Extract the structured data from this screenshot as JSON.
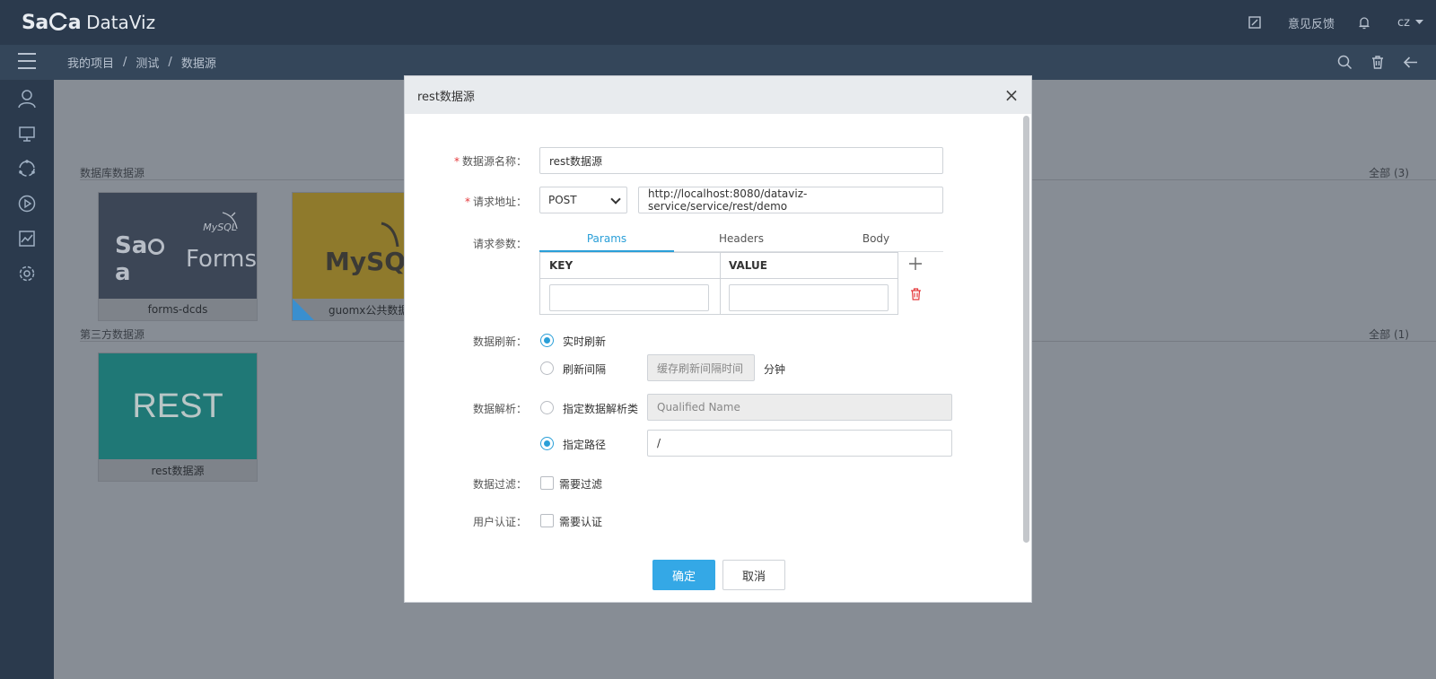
{
  "app": {
    "logo_text": "DataViz",
    "feedback": "意见反馈",
    "user": "cz"
  },
  "breadcrumb": [
    "我的项目",
    "测试",
    "数据源"
  ],
  "breadcrumb_sep": "/",
  "sections": {
    "database": {
      "title": "数据库数据源",
      "count": "全部  (3)"
    },
    "third_party": {
      "title": "第三方数据源",
      "count": "全部  (1)"
    }
  },
  "cards": {
    "forms": {
      "caption": "forms-dcds",
      "logo_text": "Forms",
      "badge": "MySQL"
    },
    "mysql": {
      "caption": "guomx公共数据",
      "logo_text": "MySQL"
    },
    "rest": {
      "caption": "rest数据源",
      "logo_text": "REST"
    }
  },
  "colors": {
    "forms_bg": "#3c4656",
    "mysql_bg": "#8f7a2c",
    "rest_bg": "#1f7876",
    "accent": "#34a8e6"
  },
  "modal": {
    "title": "rest数据源",
    "close": "×",
    "fields": {
      "name_label": "数据源名称：",
      "name_value": "rest数据源",
      "url_label": "请求地址：",
      "method": "POST",
      "url_value": "http://localhost:8080/dataviz-service/service/rest/demo",
      "params_label": "请求参数：",
      "tabs": [
        "Params",
        "Headers",
        "Body"
      ],
      "kv_headers": [
        "KEY",
        "VALUE"
      ],
      "refresh_label": "数据刷新：",
      "refresh_realtime": "实时刷新",
      "refresh_interval": "刷新间隔",
      "refresh_interval_placeholder": "缓存刷新间隔时间",
      "refresh_unit": "分钟",
      "parse_label": "数据解析：",
      "parse_class": "指定数据解析类",
      "parse_class_placeholder": "Qualified Name",
      "parse_path": "指定路径",
      "parse_path_value": "/",
      "filter_label": "数据过滤：",
      "filter_option": "需要过滤",
      "auth_label": "用户认证：",
      "auth_option": "需要认证"
    },
    "ok": "确定",
    "cancel": "取消"
  }
}
